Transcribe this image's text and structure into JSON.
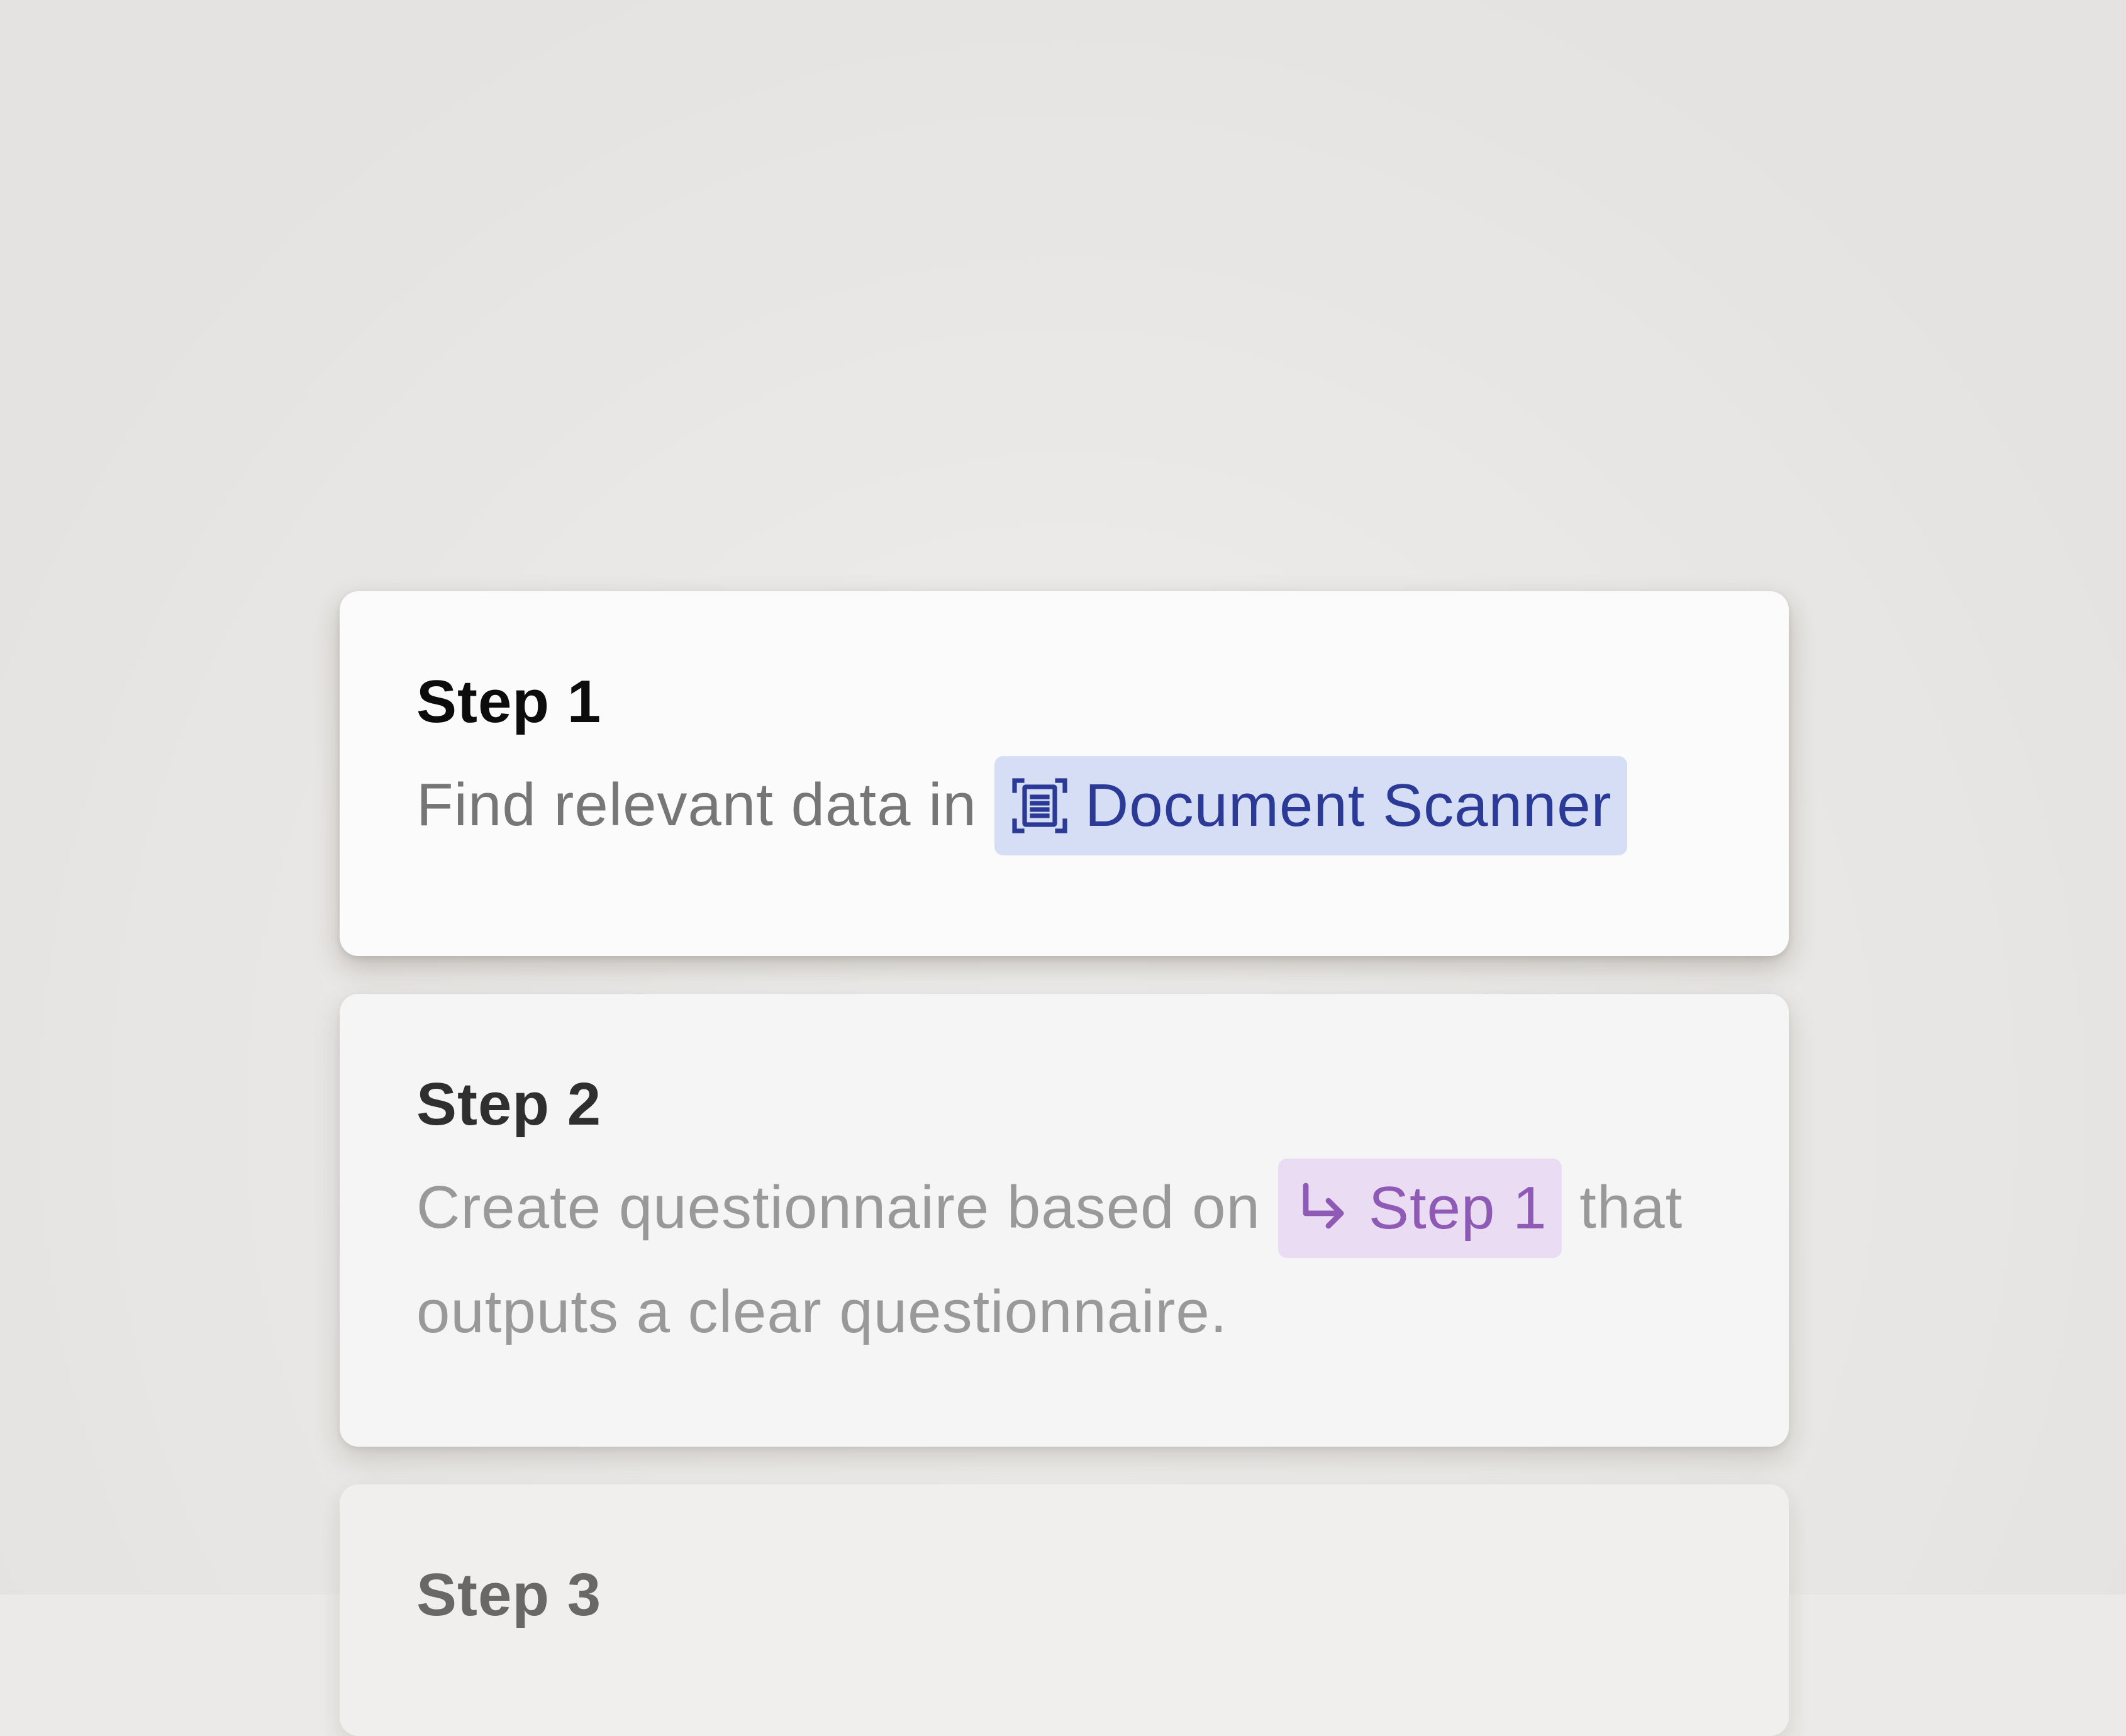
{
  "steps": [
    {
      "title": "Step 1",
      "text_before": "Find relevant data in",
      "chip": {
        "label": "Document Scanner",
        "icon": "document-scanner-icon",
        "color": "#2a3a96",
        "background": "#d6def6"
      },
      "text_after": ""
    },
    {
      "title": "Step 2",
      "text_before": "Create questionnaire based on",
      "chip": {
        "label": "Step 1",
        "icon": "return-arrow-icon",
        "color": "#8f5ab5",
        "background": "#eadcf2"
      },
      "text_after": "that outputs a clear questionnaire."
    },
    {
      "title": "Step 3"
    }
  ]
}
